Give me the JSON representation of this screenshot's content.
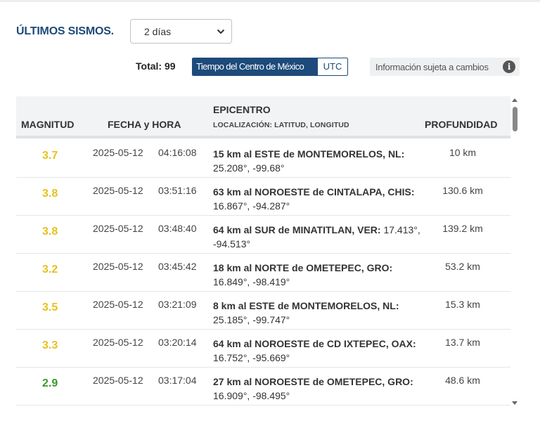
{
  "header": {
    "title": "ÚLTIMOS SISMOS.",
    "period_select": {
      "value": "2 días"
    },
    "total_label": "Total: 99",
    "time_toggle": {
      "active": "Tiempo del Centro de México",
      "inactive": "UTC"
    },
    "info_notice": "Información sujeta a cambios",
    "info_icon": "info-icon"
  },
  "table": {
    "columns": {
      "magnitude": "MAGNITUD",
      "datetime": "FECHA y HORA",
      "epicenter": "EPICENTRO",
      "epicenter_sub": "LOCALIZACIÓN: LATITUD, LONGITUD",
      "depth": "PROFUNDIDAD"
    },
    "rows": [
      {
        "magnitude": "3.7",
        "color": "#e6c21f",
        "date": "2025-05-12",
        "time": "04:16:08",
        "place": "15 km al ESTE de MONTEMORELOS, NL:",
        "coords": "25.208°, -99.68°",
        "depth": "10 km"
      },
      {
        "magnitude": "3.8",
        "color": "#e6c21f",
        "date": "2025-05-12",
        "time": "03:51:16",
        "place": "63 km al NOROESTE de CINTALAPA, CHIS:",
        "coords": "16.867°, -94.287°",
        "depth": "130.6 km"
      },
      {
        "magnitude": "3.8",
        "color": "#e6c21f",
        "date": "2025-05-12",
        "time": "03:48:40",
        "place": "64 km al SUR de MINATITLAN, VER:",
        "coords": "17.413°, -94.513°",
        "depth": "139.2 km"
      },
      {
        "magnitude": "3.2",
        "color": "#e6c21f",
        "date": "2025-05-12",
        "time": "03:45:42",
        "place": "18 km al NORTE de OMETEPEC, GRO:",
        "coords": "16.849°, -98.419°",
        "depth": "53.2 km"
      },
      {
        "magnitude": "3.5",
        "color": "#e6c21f",
        "date": "2025-05-12",
        "time": "03:21:09",
        "place": "8 km al ESTE de MONTEMORELOS, NL:",
        "coords": "25.185°, -99.747°",
        "depth": "15.3 km"
      },
      {
        "magnitude": "3.3",
        "color": "#e6c21f",
        "date": "2025-05-12",
        "time": "03:20:14",
        "place": "64 km al NOROESTE de CD IXTEPEC, OAX:",
        "coords": "16.752°, -95.669°",
        "depth": "13.7 km"
      },
      {
        "magnitude": "2.9",
        "color": "#3a9a2a",
        "date": "2025-05-12",
        "time": "03:17:04",
        "place": "27 km al NOROESTE de OMETEPEC, GRO:",
        "coords": "16.909°, -98.495°",
        "depth": "48.6 km"
      }
    ]
  }
}
